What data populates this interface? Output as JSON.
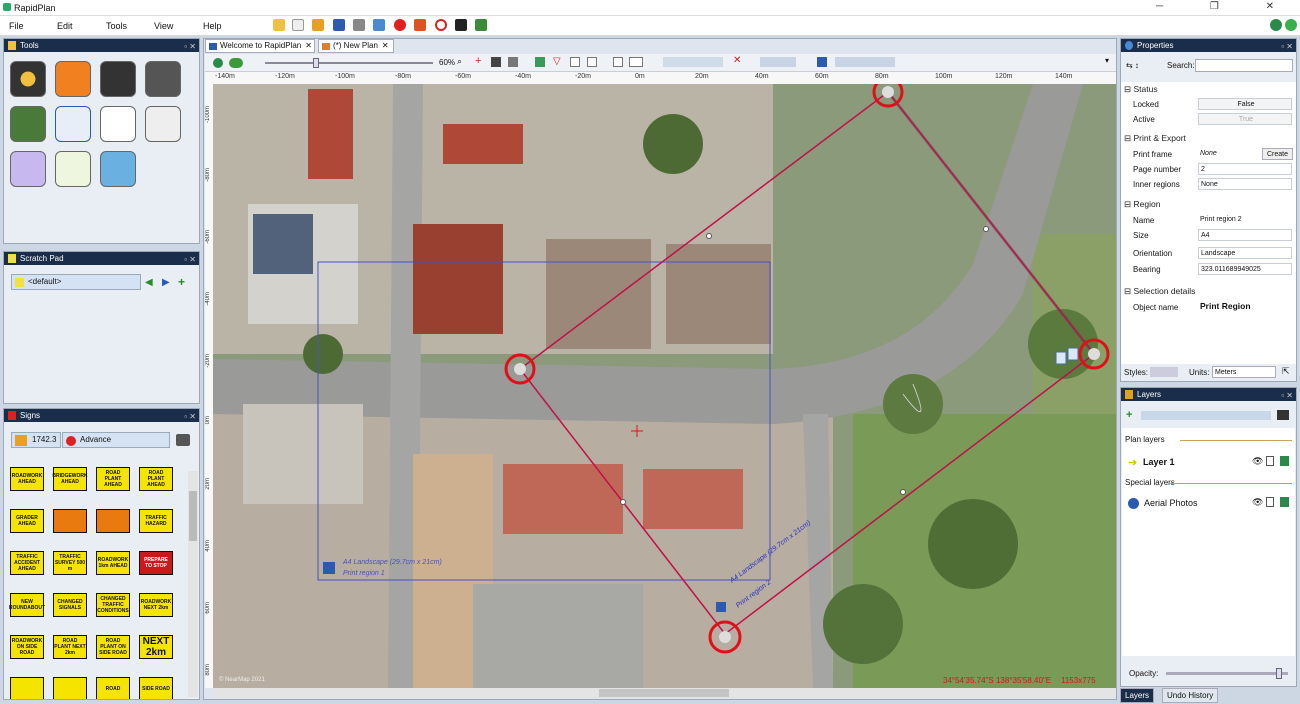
{
  "app": {
    "title": "RapidPlan"
  },
  "menu": [
    "File",
    "Edit",
    "Tools",
    "View",
    "Help"
  ],
  "tabs": [
    {
      "label": "Welcome to RapidPlan"
    },
    {
      "label": "(*) New Plan"
    }
  ],
  "zoom": "60%",
  "panels": {
    "tools": "Tools",
    "scratch": "Scratch Pad",
    "signs": "Signs",
    "properties": "Properties",
    "layers": "Layers"
  },
  "scratch": {
    "item": "<default>"
  },
  "signs": {
    "code": "1742.3",
    "mode": "Advance",
    "items": [
      "ROADWORK AHEAD",
      "BRIDGEWORK AHEAD",
      "ROAD PLANT AHEAD",
      "ROAD PLANT AHEAD",
      "GRADER AHEAD",
      "",
      "",
      "TRAFFIC HAZARD",
      "TRAFFIC ACCIDENT AHEAD",
      "TRAFFIC SURVEY 500 m",
      "ROADWORK 1km AHEAD",
      "PREPARE TO STOP",
      "NEW ROUNDABOUT",
      "CHANGED SIGNALS",
      "CHANGED TRAFFIC CONDITIONS",
      "ROADWORK NEXT 2km",
      "ROADWORK ON SIDE ROAD",
      "ROAD PLANT NEXT 2km",
      "ROAD PLANT ON SIDE ROAD",
      "NEXT 2km",
      "",
      "",
      "ROAD",
      "SIDE ROAD"
    ]
  },
  "ruler": {
    "x": [
      "-140m",
      "-120m",
      "-100m",
      "-80m",
      "-60m",
      "-40m",
      "-20m",
      "0m",
      "20m",
      "40m",
      "60m",
      "80m",
      "100m",
      "120m",
      "140m"
    ],
    "y": [
      "-100m",
      "-80m",
      "-60m",
      "-40m",
      "-20m",
      "0m",
      "20m",
      "40m",
      "60m",
      "80m"
    ]
  },
  "map": {
    "label1": "A4 Landscape (29.7cm x 21cm)",
    "label1b": "Print region 1",
    "label2": "A4 Landscape (29.7cm x 21cm)",
    "label2b": "Print region 2",
    "copyright": "© NearMap 2021",
    "coords": "34°54'35.74\"S 138°35'58.40\"E",
    "dims": "1153x775"
  },
  "properties": {
    "search_label": "Search:",
    "status": "Status",
    "locked_label": "Locked",
    "locked": "False",
    "active_label": "Active",
    "active": "True",
    "print_export": "Print & Export",
    "print_frame_label": "Print frame",
    "print_frame": "None",
    "create": "Create",
    "page_number_label": "Page number",
    "page_number": "2",
    "inner_regions_label": "Inner regions",
    "inner_regions": "None",
    "region": "Region",
    "name_label": "Name",
    "name": "Print region 2",
    "size_label": "Size",
    "size": "A4",
    "orientation_label": "Orientation",
    "orientation": "Landscape",
    "bearing_label": "Bearing",
    "bearing": "323.011689949025",
    "selection": "Selection details",
    "object_name_label": "Object name",
    "object_name": "Print Region",
    "styles": "Styles:",
    "units_label": "Units:",
    "units": "Meters"
  },
  "layers": {
    "plan_layers": "Plan layers",
    "layer1": "Layer 1",
    "special_layers": "Special layers",
    "aerial": "Aerial Photos",
    "opacity": "Opacity:",
    "opacity_value": 0.95,
    "tab_layers": "Layers",
    "tab_undo": "Undo History"
  },
  "colors": {
    "panel_head": "#1a2d4a",
    "accent": "#e0101a",
    "region": "#c0104a"
  }
}
